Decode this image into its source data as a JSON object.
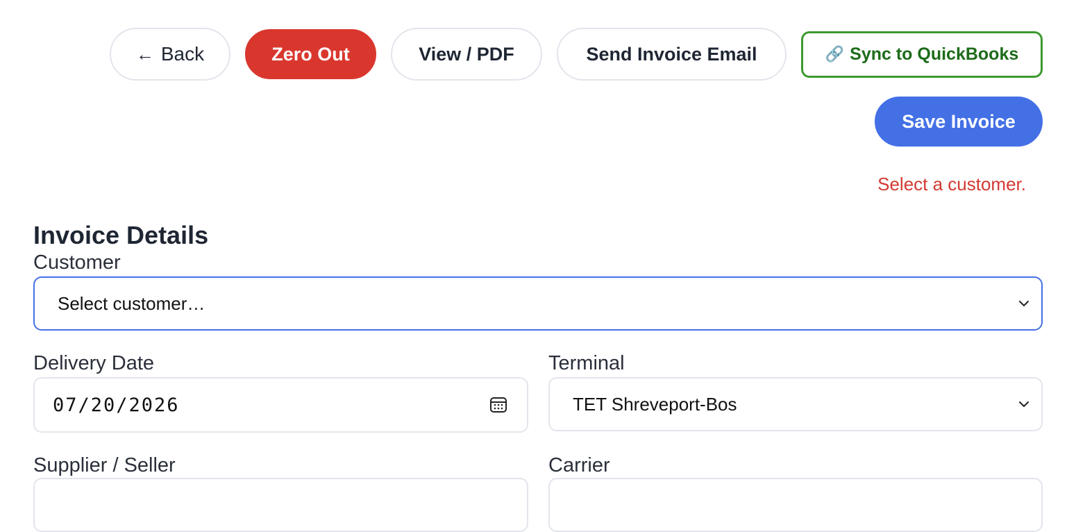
{
  "toolbar": {
    "back_label": "Back",
    "zero_out_label": "Zero Out",
    "view_pdf_label": "View / PDF",
    "send_email_label": "Send Invoice Email",
    "sync_label": "Sync to QuickBooks",
    "save_label": "Save Invoice"
  },
  "validation": {
    "message": "Select a customer."
  },
  "invoice": {
    "section_title": "Invoice Details",
    "customer": {
      "label": "Customer",
      "value": "Select customer…"
    },
    "delivery_date": {
      "label": "Delivery Date",
      "value": "07/20/2026"
    },
    "terminal": {
      "label": "Terminal",
      "value": "TET Shreveport-Bos"
    },
    "supplier": {
      "label": "Supplier / Seller"
    },
    "carrier": {
      "label": "Carrier"
    }
  },
  "colors": {
    "danger": "#d9372e",
    "primary": "#4470e6",
    "sync_green": "#3b9a2d",
    "error_text": "#d23a32"
  },
  "icons": [
    "arrow-left-icon",
    "link-icon",
    "chevron-down-icon",
    "calendar-icon"
  ]
}
